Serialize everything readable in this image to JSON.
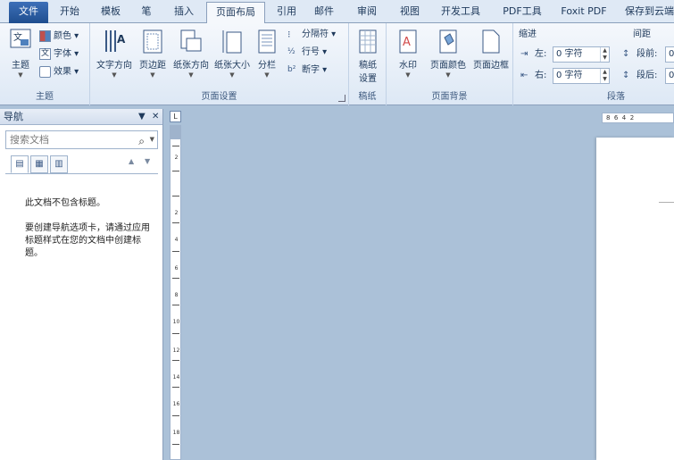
{
  "tabs": [
    {
      "label": "文件"
    },
    {
      "label": "开始"
    },
    {
      "label": "模板"
    },
    {
      "label": "笔"
    },
    {
      "label": "插入"
    },
    {
      "label": "页面布局"
    },
    {
      "label": "引用"
    },
    {
      "label": "邮件"
    },
    {
      "label": "审阅"
    },
    {
      "label": "视图"
    },
    {
      "label": "开发工具"
    },
    {
      "label": "PDF工具"
    },
    {
      "label": "Foxit PDF"
    },
    {
      "label": "保存到云端"
    }
  ],
  "ribbon": {
    "theme_group": {
      "label": "主题",
      "themes_btn": "主题",
      "colors": "颜色",
      "fonts": "字体",
      "effects": "效果"
    },
    "page_setup_group": {
      "label": "页面设置",
      "text_direction": "文字方向",
      "margins": "页边距",
      "orientation": "纸张方向",
      "size": "纸张大小",
      "columns": "分栏",
      "breaks": "分隔符",
      "line_numbers": "行号",
      "hyphenation": "断字"
    },
    "draft_group": {
      "label": "稿纸",
      "draft_settings_line1": "稿纸",
      "draft_settings_line2": "设置"
    },
    "background_group": {
      "label": "页面背景",
      "watermark": "水印",
      "page_color": "页面颜色",
      "page_borders": "页面边框"
    },
    "paragraph_group": {
      "label": "段落",
      "indent_title": "缩进",
      "spacing_title": "间距",
      "indent_left_label": "左:",
      "indent_left_value": "0 字符",
      "indent_right_label": "右:",
      "indent_right_value": "0 字符",
      "spacing_before_label": "段前:",
      "spacing_after_label": "段后:",
      "spacing_before_value": "0",
      "spacing_after_value": "0"
    }
  },
  "nav": {
    "title": "导航",
    "search_placeholder": "搜索文档",
    "no_headings": "此文档不包含标题。",
    "instructions": "要创建导航选项卡，请通过应用标题样式在您的文档中创建标题。"
  },
  "ruler": {
    "corner": "L",
    "h_numbers": "8  6  4  2",
    "v_numbers": [
      "2",
      "2",
      "4",
      "6",
      "8",
      "10",
      "12",
      "14",
      "16",
      "18"
    ]
  }
}
